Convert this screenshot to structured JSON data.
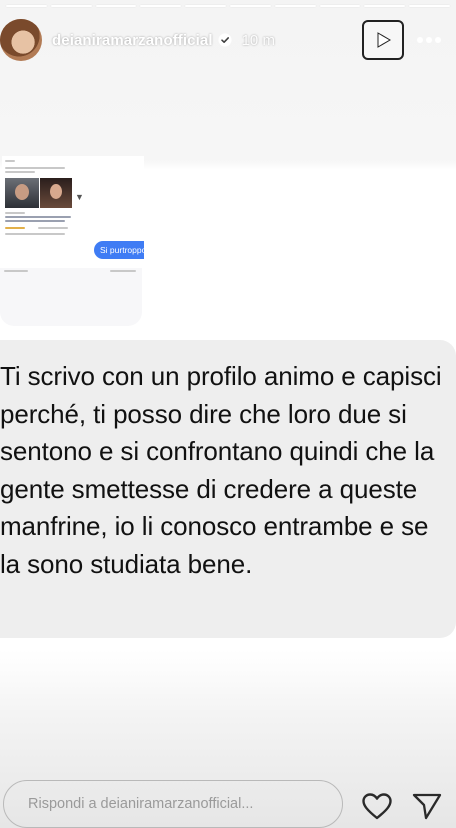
{
  "story": {
    "progress_segments": 10,
    "active_segment": 10
  },
  "header": {
    "username": "deianiramarzanofficial",
    "verified": true,
    "time_ago": "10 m",
    "play_icon": "play-icon",
    "more_icon": "more-icon"
  },
  "embedded_screenshot": {
    "bubble_text": "Si purtroppo"
  },
  "message": {
    "text": "Ti scrivo con un profilo animo e capisci perché, ti posso dire che loro due si sentono e si confrontano quindi che la gente smettesse di credere a queste manfrine, io li conosco entrambe e se la sono studiata bene."
  },
  "reply_bar": {
    "placeholder": "Rispondi a deianiramarzanofficial...",
    "heart_icon": "heart-icon",
    "send_icon": "send-icon"
  },
  "colors": {
    "bubble_blue": "#3f7cf4",
    "message_bg": "#eeeeee",
    "text": "#111111",
    "placeholder": "#9a9a9a"
  }
}
